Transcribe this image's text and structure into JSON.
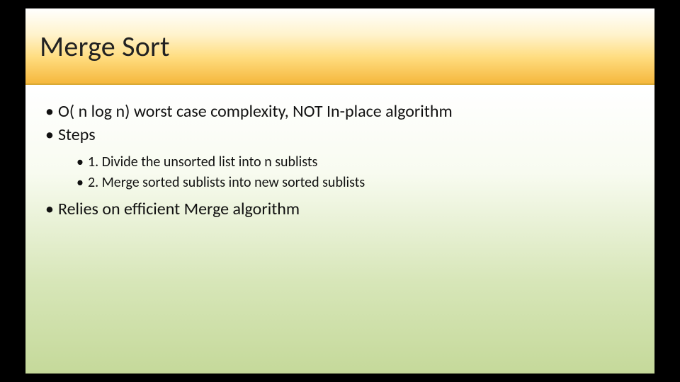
{
  "title": "Merge Sort",
  "bullets": {
    "b1": "O( n log n) worst case complexity, NOT In-place algorithm",
    "b2": "Steps",
    "b2_sub": {
      "s1": "1. Divide the unsorted list into n sublists",
      "s2": "2. Merge sorted sublists into new sorted sublists"
    },
    "b3": "Relies on efficient Merge algorithm"
  }
}
